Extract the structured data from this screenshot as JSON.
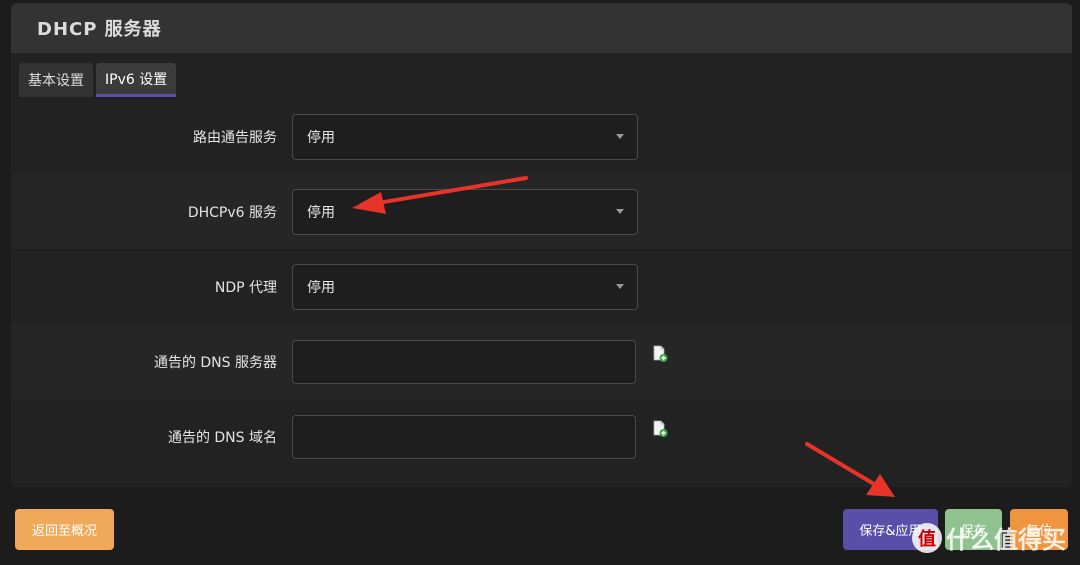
{
  "header": {
    "title": "DHCP 服务器"
  },
  "tabs": [
    {
      "label": "基本设置",
      "active": false
    },
    {
      "label": "IPv6 设置",
      "active": true
    }
  ],
  "fields": {
    "ra_service": {
      "label": "路由通告服务",
      "value": "停用"
    },
    "dhcpv6_service": {
      "label": "DHCPv6 服务",
      "value": "停用"
    },
    "ndp_proxy": {
      "label": "NDP 代理",
      "value": "停用"
    },
    "dns_servers": {
      "label": "通告的 DNS 服务器",
      "value": "",
      "placeholder": ""
    },
    "dns_domains": {
      "label": "通告的 DNS 域名",
      "value": "",
      "placeholder": ""
    }
  },
  "footer": {
    "back_label": "返回至概况",
    "save_apply_label": "保存&应用",
    "save_label": "保存",
    "reset_label": "复位"
  },
  "watermark": {
    "logo": "值",
    "text": "什么值得买"
  },
  "colors": {
    "back_button": "#f0a95b",
    "save_apply_button": "#5a4fa8",
    "save_button": "#8fc28e",
    "reset_button": "#f0953f",
    "annotation_arrow": "#e8332a"
  },
  "icons": {
    "add_entry": "add-document-icon"
  }
}
